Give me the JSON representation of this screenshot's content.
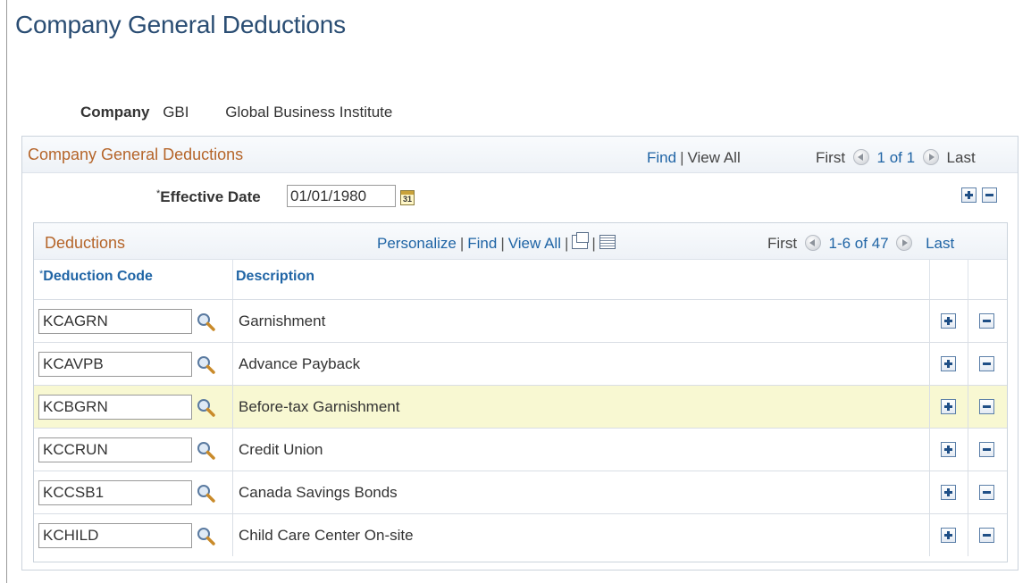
{
  "page_title": "Company General Deductions",
  "company": {
    "label": "Company",
    "code": "GBI",
    "name": "Global Business Institute"
  },
  "outer": {
    "title": "Company General Deductions",
    "find": "Find",
    "view_all": "View All",
    "first": "First",
    "range": "1 of 1",
    "last": "Last",
    "effective_date_label": "Effective Date",
    "effective_date_value": "01/01/1980",
    "calendar_day": "31"
  },
  "grid": {
    "title": "Deductions",
    "personalize": "Personalize",
    "find": "Find",
    "view_all": "View All",
    "first": "First",
    "range": "1-6 of 47",
    "last": "Last",
    "columns": {
      "code": "Deduction Code",
      "description": "Description"
    },
    "rows": [
      {
        "code": "KCAGRN",
        "description": "Garnishment"
      },
      {
        "code": "KCAVPB",
        "description": "Advance Payback"
      },
      {
        "code": "KCBGRN",
        "description": "Before-tax Garnishment"
      },
      {
        "code": "KCCRUN",
        "description": "Credit Union"
      },
      {
        "code": "KCCSB1",
        "description": "Canada Savings Bonds"
      },
      {
        "code": "KCHILD",
        "description": "Child Care Center On-site"
      }
    ],
    "highlighted_row": 2
  },
  "icons": {
    "lookup": "magnifying-glass-icon",
    "calendar": "calendar-icon",
    "add": "plus-icon",
    "delete": "minus-icon",
    "prev": "arrow-left-icon",
    "next": "arrow-right-icon"
  },
  "colors": {
    "title": "#2a4d73",
    "link": "#1f64a5",
    "section_title": "#b5652a",
    "highlight_row": "#f8f8d2"
  }
}
